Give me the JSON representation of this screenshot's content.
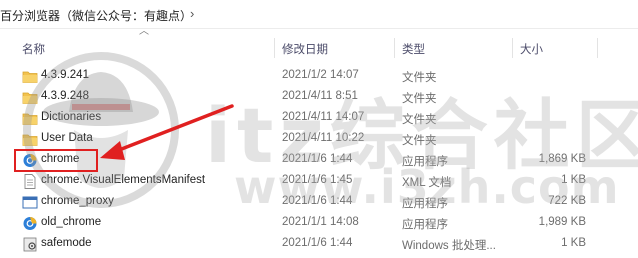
{
  "breadcrumb": {
    "text": "百分浏览器（微信公众号：有趣点）"
  },
  "columns": {
    "name": "名称",
    "date": "修改日期",
    "type": "类型",
    "size": "大小"
  },
  "files": [
    {
      "name": "4.3.9.241",
      "date": "2021/1/2 14:07",
      "type": "文件夹",
      "size": "",
      "icon": "folder-icon"
    },
    {
      "name": "4.3.9.248",
      "date": "2021/4/11 8:51",
      "type": "文件夹",
      "size": "",
      "icon": "folder-icon"
    },
    {
      "name": "Dictionaries",
      "date": "2021/4/11 14:07",
      "type": "文件夹",
      "size": "",
      "icon": "folder-icon"
    },
    {
      "name": "User Data",
      "date": "2021/4/11 10:22",
      "type": "文件夹",
      "size": "",
      "icon": "folder-icon"
    },
    {
      "name": "chrome",
      "date": "2021/1/6 1:44",
      "type": "应用程序",
      "size": "1,869 KB",
      "icon": "app-icon"
    },
    {
      "name": "chrome.VisualElementsManifest",
      "date": "2021/1/6 1:45",
      "type": "XML 文档",
      "size": "1 KB",
      "icon": "document-icon"
    },
    {
      "name": "chrome_proxy",
      "date": "2021/1/6 1:44",
      "type": "应用程序",
      "size": "722 KB",
      "icon": "window-app-icon"
    },
    {
      "name": "old_chrome",
      "date": "2021/1/1 14:08",
      "type": "应用程序",
      "size": "1,989 KB",
      "icon": "app-icon"
    },
    {
      "name": "safemode",
      "date": "2021/1/6 1:44",
      "type": "Windows 批处理...",
      "size": "1 KB",
      "icon": "batch-file-icon"
    }
  ],
  "watermark": {
    "text": "itz综合社区",
    "url": "www.i3zh.com"
  },
  "colors": {
    "highlight": "#e02020",
    "folder": "#f2c24f",
    "app_blue": "#2d7fd8"
  }
}
